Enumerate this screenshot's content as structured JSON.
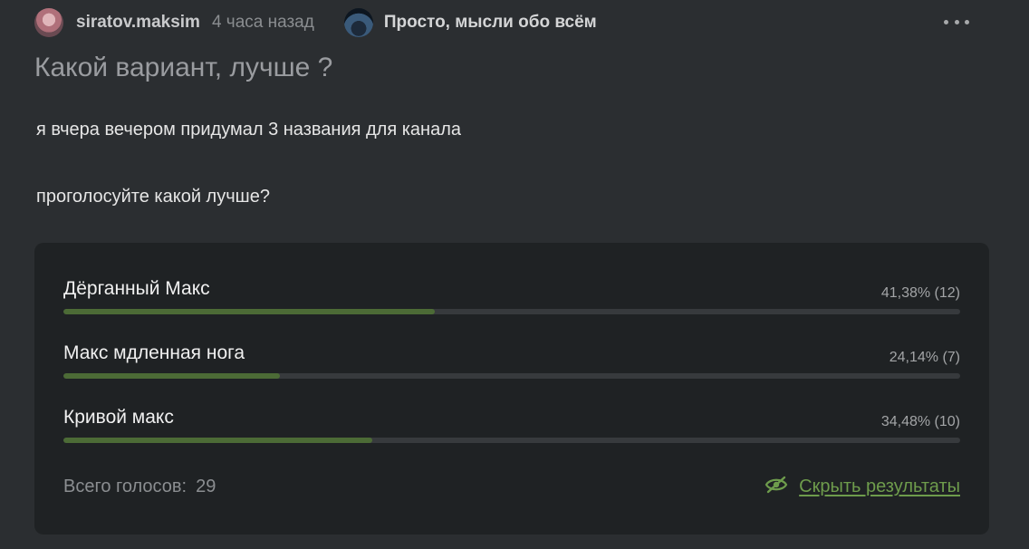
{
  "post": {
    "author": "siratov.maksim",
    "time": "4 часа назад",
    "channel": "Просто, мысли обо всём",
    "title": "Какой вариант, лучше ?",
    "body_lines": [
      "я вчера вечером придумал 3 названия для канала",
      "проголосуйте какой лучше?"
    ]
  },
  "icons": {
    "more": "more-horizontal-icon",
    "hide": "eye-off-icon"
  },
  "poll": {
    "options": [
      {
        "label": "Дёрганный Макс",
        "result": "41,38% (12)",
        "percent": 41.38,
        "votes": 12
      },
      {
        "label": "Макс мдленная нога",
        "result": "24,14% (7)",
        "percent": 24.14,
        "votes": 7
      },
      {
        "label": "Кривой макс",
        "result": "34,48% (10)",
        "percent": 34.48,
        "votes": 10
      }
    ],
    "total_label": "Всего голосов:",
    "total_count": "29",
    "hide_results_label": "Скрыть результаты"
  },
  "colors": {
    "background": "#2b2e31",
    "poll_background": "#1f2224",
    "bar_fill": "#4c6b36",
    "bar_track": "#373a3d",
    "accent": "#6e9c4c"
  }
}
